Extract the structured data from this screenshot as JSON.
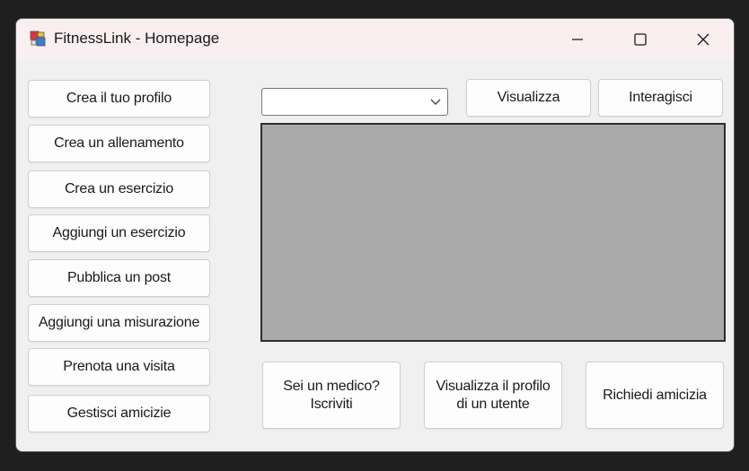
{
  "window": {
    "title": "FitnessLink - Homepage"
  },
  "sidebar": {
    "buttons": [
      {
        "label": "Crea il tuo profilo"
      },
      {
        "label": "Crea un allenamento"
      },
      {
        "label": "Crea un esercizio"
      },
      {
        "label": "Aggiungi un esercizio"
      },
      {
        "label": "Pubblica un post"
      },
      {
        "label": "Aggiungi una misurazione"
      },
      {
        "label": "Prenota una visita"
      },
      {
        "label": "Gestisci amicizie"
      }
    ]
  },
  "toolbar": {
    "combo_value": "",
    "visualizza_label": "Visualizza",
    "interagisci_label": "Interagisci"
  },
  "bottom": {
    "medico_label": "Sei un medico?\nIscriviti",
    "profilo_label": "Visualizza il profilo\ndi un utente",
    "amicizia_label": "Richiedi amicizia"
  },
  "icons": {
    "app": "app-icon",
    "minimize": "minimize-icon",
    "maximize": "maximize-icon",
    "close": "close-icon",
    "dropdown": "chevron-down-icon"
  },
  "colors": {
    "titlebar": "#f9eef0",
    "window": "#f0f0f0",
    "display_panel": "#aaaaaa"
  }
}
